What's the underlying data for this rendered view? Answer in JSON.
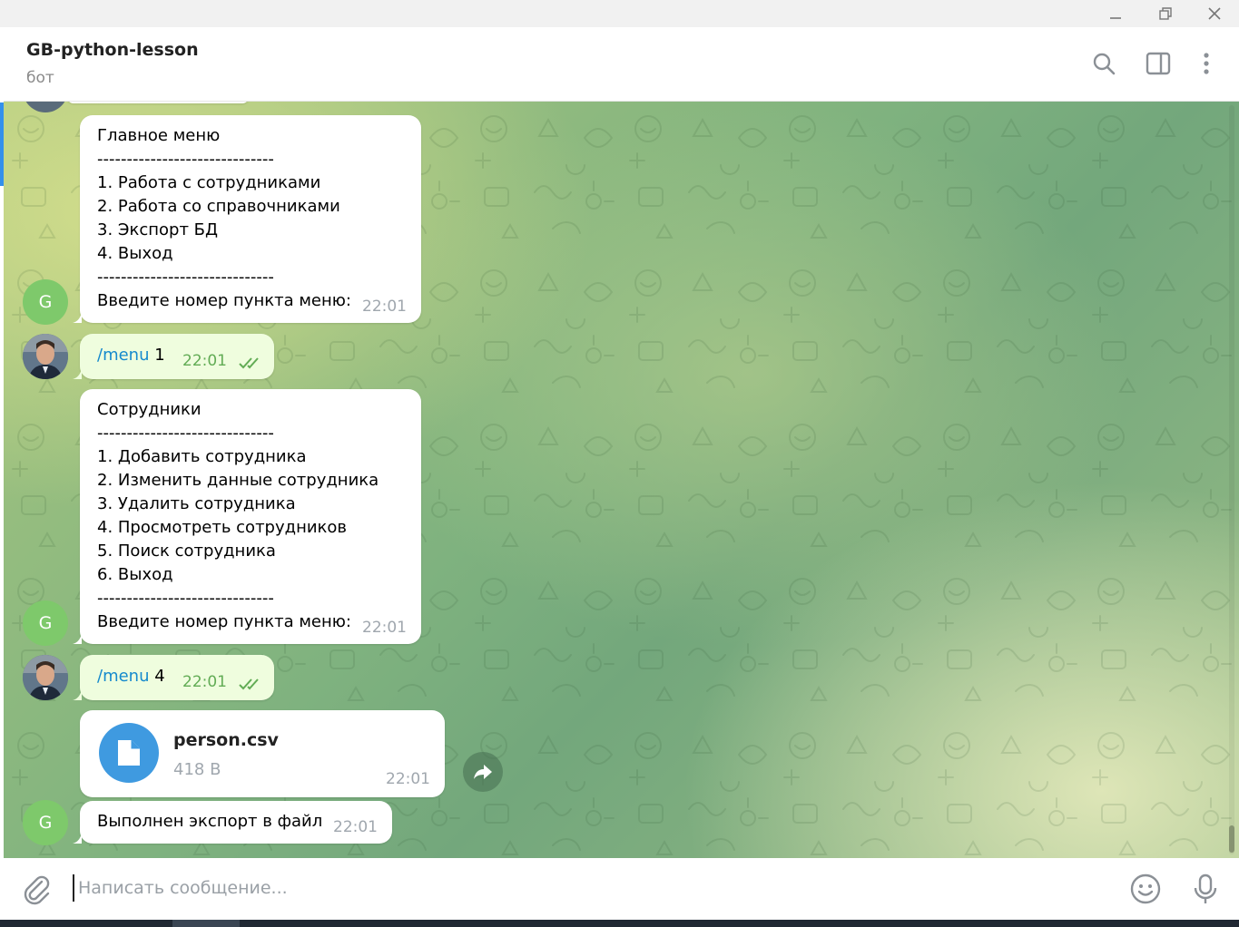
{
  "header": {
    "title": "GB-python-lesson",
    "status": "бот"
  },
  "icons": {
    "search": "search-icon",
    "sidebar_toggle": "sidebar-panel-icon",
    "more": "more-vertical-icon",
    "attach": "paperclip-icon",
    "emoji": "smile-icon",
    "mic": "microphone-icon",
    "share": "forward-arrow-icon",
    "file": "document-icon",
    "read": "double-check-icon"
  },
  "colors": {
    "accent": "#3390ec",
    "bot_avatar": "#7ec96b",
    "outgoing_bubble": "#effdde",
    "command_link": "#168acd",
    "read_check": "#62ac55"
  },
  "messages": [
    {
      "id": "main-menu",
      "sender": "bot",
      "avatar_letter": "G",
      "text": "Главное меню\n------------------------------\n1. Работа с сотрудниками\n2. Работа со справочниками\n3. Экспорт БД\n4. Выход\n------------------------------\nВведите номер пункта меню:",
      "time": "22:01"
    },
    {
      "id": "reply-1",
      "sender": "user",
      "command": "/menu",
      "arg": " 1",
      "time": "22:01"
    },
    {
      "id": "employees-menu",
      "sender": "bot",
      "avatar_letter": "G",
      "text": "Сотрудники\n------------------------------\n1. Добавить сотрудника\n2. Изменить данные сотрудника\n3. Удалить сотрудника\n4. Просмотреть сотрудников\n5. Поиск сотрудника\n6. Выход\n------------------------------\nВведите номер пункта меню:",
      "time": "22:01"
    },
    {
      "id": "reply-4",
      "sender": "user",
      "command": "/menu",
      "arg": " 4",
      "time": "22:01"
    },
    {
      "id": "file",
      "sender": "bot",
      "file_name": "person.csv",
      "file_size": "418 B",
      "time": "22:01"
    },
    {
      "id": "export-done",
      "sender": "bot",
      "avatar_letter": "G",
      "text": "Выполнен экспорт в файл",
      "time": "22:01"
    }
  ],
  "composer": {
    "placeholder": "Написать сообщение..."
  }
}
